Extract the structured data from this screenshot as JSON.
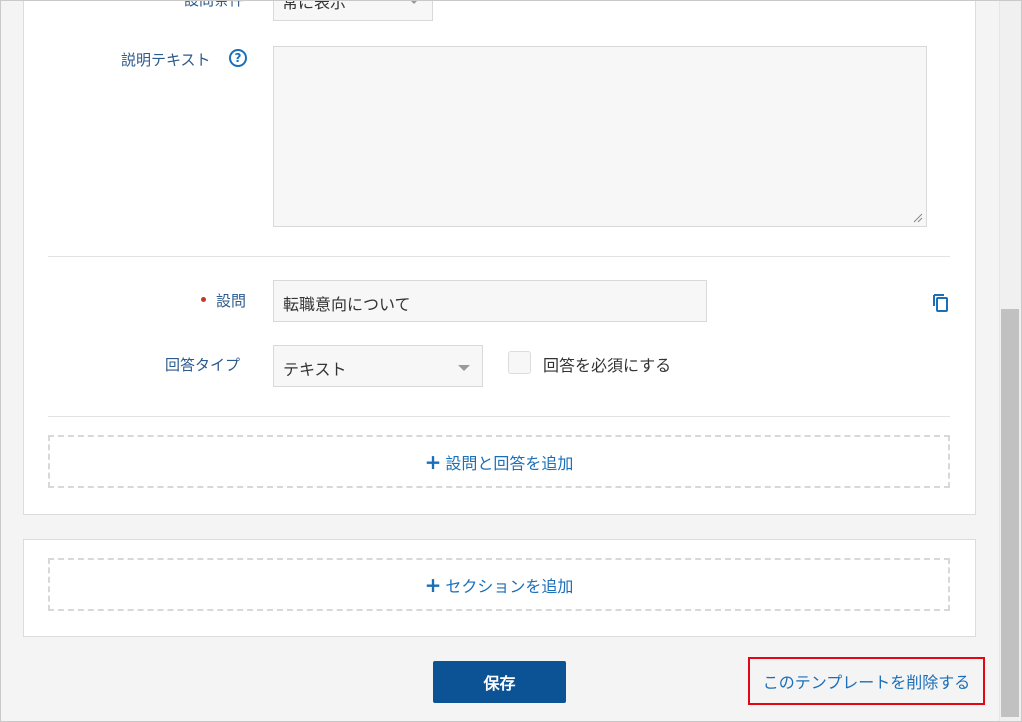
{
  "condition": {
    "label": "設問条件",
    "select_value": "常に表示"
  },
  "description": {
    "label": "説明テキスト",
    "help_icon": "help-icon",
    "value": ""
  },
  "question": {
    "label": "設問",
    "value": "転職意向について",
    "copy_icon": "copy-icon"
  },
  "answer_type": {
    "label": "回答タイプ",
    "select_value": "テキスト",
    "required_label": "回答を必須にする",
    "required_checked": false
  },
  "add_question": {
    "plus": "+",
    "label": "設問と回答を追加"
  },
  "add_section": {
    "plus": "+",
    "label": "セクションを追加"
  },
  "footer": {
    "save_label": "保存",
    "delete_label": "このテンプレートを削除する"
  },
  "colors": {
    "primary": "#0c5396",
    "link": "#1a6fb8",
    "label": "#2c5a8c",
    "highlight": "#e30613",
    "required": "#c0392b"
  }
}
